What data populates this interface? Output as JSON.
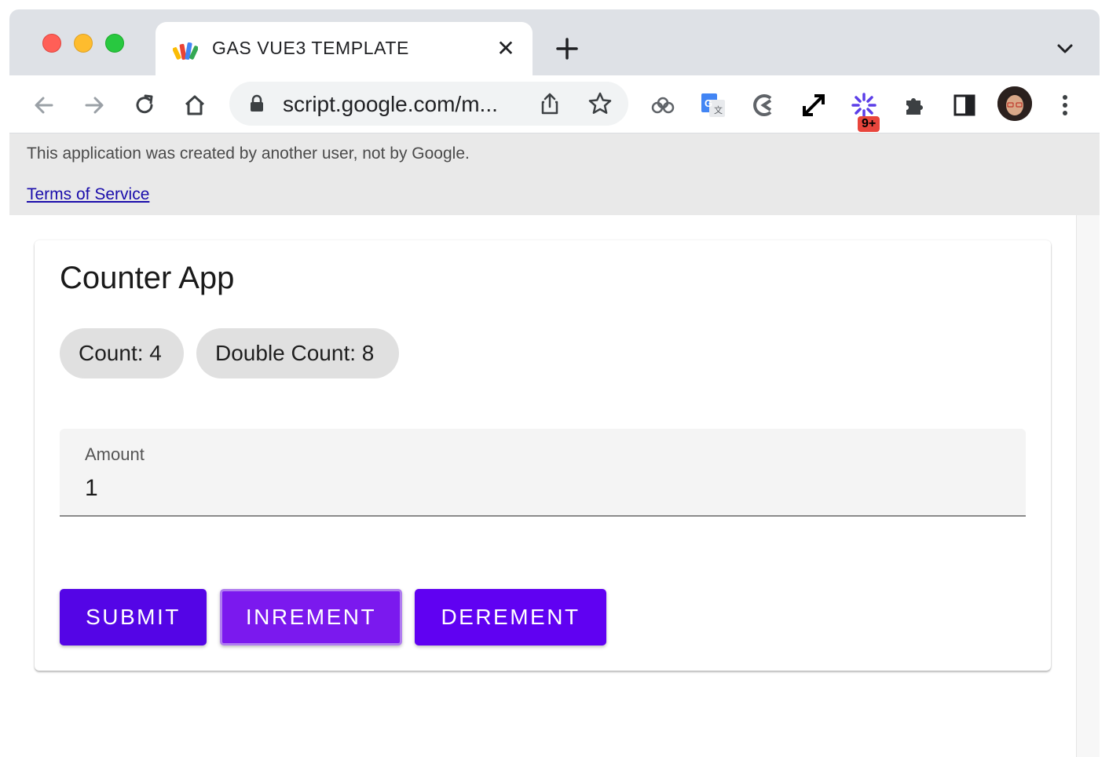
{
  "browser": {
    "tab": {
      "title": "GAS VUE3 TEMPLATE",
      "close_glyph": "✕"
    },
    "new_tab_glyph": "+",
    "omnibox": {
      "url": "script.google.com/m..."
    },
    "extensions_badge": "9+",
    "icons": [
      "back-icon",
      "forward-icon",
      "reload-icon",
      "home-icon",
      "lock-icon",
      "share-icon",
      "bookmark-star-icon",
      "cloud-extension-icon",
      "google-translate-icon",
      "extension-c-icon",
      "fullscreen-expand-icon",
      "sparkle-extension-icon",
      "puzzle-extensions-icon",
      "side-panel-icon",
      "profile-avatar",
      "kebab-menu-icon",
      "tab-search-chevron-icon"
    ]
  },
  "banner": {
    "text": "This application was created by another user, not by Google.",
    "link": "Terms of Service"
  },
  "app": {
    "title": "Counter App",
    "chips": {
      "count": "Count: 4",
      "double_count": "Double Count: 8"
    },
    "amount_field": {
      "label": "Amount",
      "value": "1"
    },
    "buttons": {
      "submit": "SUBMIT",
      "increment": "INREMENT",
      "decrement": "DEREMENT"
    },
    "colors": {
      "submit": "#5405e6",
      "increment": "#7b19ee",
      "decrement": "#6001f2"
    }
  }
}
